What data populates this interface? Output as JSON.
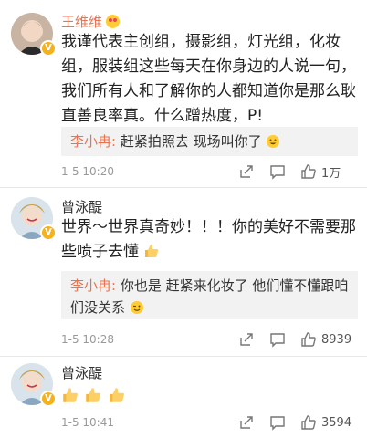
{
  "comments": [
    {
      "username": "王维维",
      "content": "我谨代表主创组，摄影组，灯光组，化妆组，服装组这些每天在你身边的人说一句，我们所有人和了解你的人都知道你是那么耿直善良率真。什么蹭热度，P!",
      "reply": {
        "user": "李小冉:",
        "text": " 赶紧拍照去 现场叫你了"
      },
      "time": "1-5 10:20",
      "likes": "1万"
    },
    {
      "username": "曾泳醍",
      "content": "世界～世界真奇妙！！！你的美好不需要那些喷子去懂",
      "reply": {
        "user": "李小冉:",
        "text": " 你也是 赶紧来化妆了 他们懂不懂跟咱们没关系"
      },
      "time": "1-5 10:28",
      "likes": "8939"
    },
    {
      "username": "曾泳醍",
      "content": "",
      "time": "1-5 10:41",
      "likes": "3594"
    }
  ],
  "icons": {
    "verified": "verified-badge-icon",
    "share": "share-icon",
    "comment": "comment-icon",
    "like": "thumbs-up-icon",
    "emoji": "thumbs-up-emoji-icon"
  },
  "colors": {
    "username": "#eb7350",
    "reply_user": "#eb7350",
    "meta": "#999999",
    "reply_bg": "#f2f2f2",
    "verified": "#f6b21c"
  }
}
